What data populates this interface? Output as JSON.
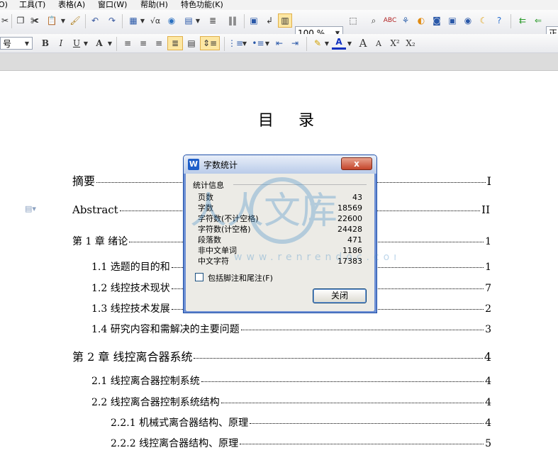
{
  "menu": [
    "O)",
    "工具(T)",
    "表格(A)",
    "窗口(W)",
    "帮助(H)",
    "特色功能(K)"
  ],
  "toolbar1": {
    "zoom": "100 %",
    "style_partial": "正"
  },
  "toolbar2": {
    "font_size_partial": "号",
    "bold": "B",
    "italic": "I",
    "underline": "U",
    "font_color": "A",
    "grow_font": "A",
    "shrink_font": "A",
    "superscript": "X²",
    "subscript": "X₂"
  },
  "document": {
    "title": "目 录",
    "toc": [
      {
        "label": "摘要",
        "page": "I"
      },
      {
        "label": "Abstract",
        "page": "II"
      },
      {
        "label": "第 1 章  绪论",
        "page": "1"
      },
      {
        "label": "1.1  选题的目的和",
        "page": "1"
      },
      {
        "label": "1.2  线控技术现状",
        "page": "7"
      },
      {
        "label": "1.3  线控技术发展",
        "page": "2"
      },
      {
        "label": "1.4  研究内容和需解决的主要问题",
        "page": "3"
      },
      {
        "label": "第 2 章  线控离合器系统",
        "page": "4"
      },
      {
        "label": "2.1 线控离合器控制系统",
        "page": "4"
      },
      {
        "label": "2.2 线控离合器控制系统结构",
        "page": "4"
      },
      {
        "label": "2.2.1  机械式离合器结构、原理",
        "page": "4"
      },
      {
        "label": "2.2.2  线控离合器结构、原理",
        "page": "5"
      }
    ]
  },
  "dialog": {
    "title": "字数统计",
    "close_x": "x",
    "group_label": "统计信息",
    "stats": [
      {
        "label": "页数",
        "value": "43"
      },
      {
        "label": "字数",
        "value": "18569"
      },
      {
        "label": "字符数(不计空格)",
        "value": "22600"
      },
      {
        "label": "字符数(计空格)",
        "value": "24428"
      },
      {
        "label": "段落数",
        "value": "471"
      },
      {
        "label": "非中文单词",
        "value": "1186"
      },
      {
        "label": "中文字符",
        "value": "17383"
      }
    ],
    "checkbox_label": "包括脚注和尾注(F)",
    "close_button": "关闭"
  },
  "watermark": {
    "text": "人人文库",
    "url": "www.renrendoc.com"
  }
}
